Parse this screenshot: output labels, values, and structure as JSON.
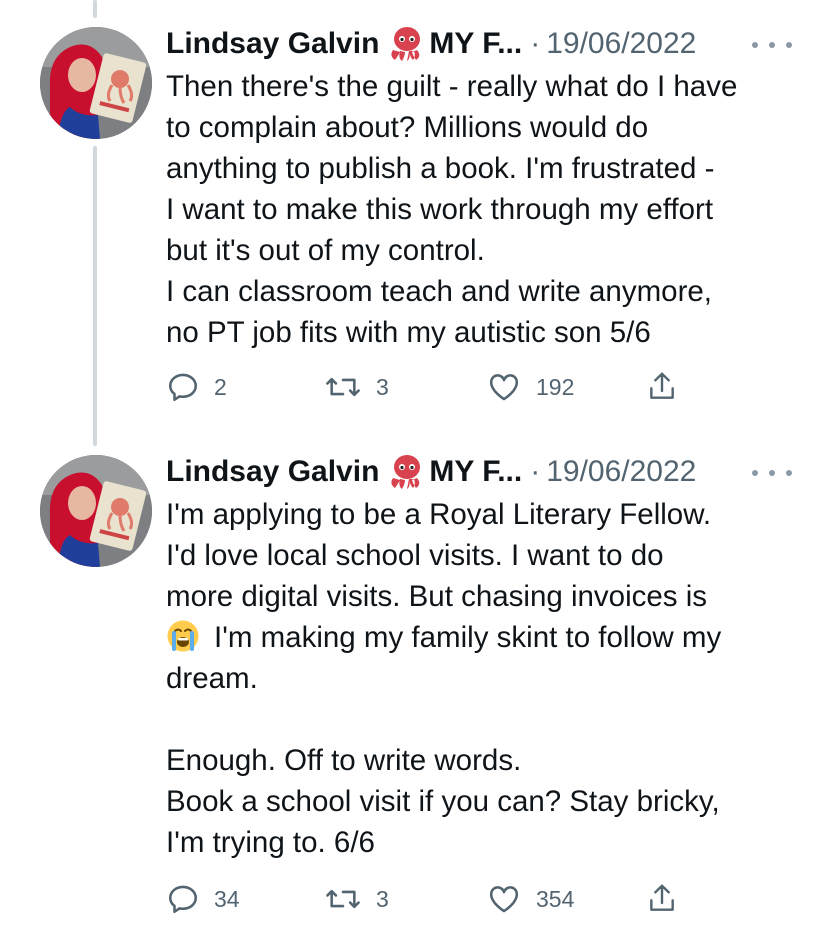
{
  "tweets": [
    {
      "author_name": "Lindsay Galvin",
      "author_suffix": "MY F...",
      "separator": "·",
      "date": "19/06/2022",
      "avatar_icon": "author-avatar",
      "lines": [
        "Then there's the guilt - really what do I have",
        "to complain about? Millions would do",
        "anything to publish a book. I'm frustrated -",
        "I want to make this work through my effort",
        "but it's out of my control.",
        "I can classroom teach and write anymore,",
        "no PT job fits with my autistic son 5/6"
      ],
      "replies": "2",
      "retweets": "3",
      "likes": "192"
    },
    {
      "author_name": "Lindsay Galvin",
      "author_suffix": "MY F...",
      "separator": "·",
      "date": "19/06/2022",
      "avatar_icon": "author-avatar",
      "lines": [
        "I'm applying to be a Royal Literary Fellow.",
        "I'd love local school visits. I want to do",
        "more digital visits. But chasing invoices is",
        "I'm making my family skint to follow my",
        "dream.",
        "",
        "Enough. Off to write words.",
        "Book a school visit if you can?  Stay bricky,",
        "I'm trying to. 6/6"
      ],
      "replies": "34",
      "retweets": "3",
      "likes": "354"
    }
  ],
  "icons": {
    "reply": "reply-icon",
    "retweet": "retweet-icon",
    "like": "like-icon",
    "share": "share-icon",
    "more": "more-options-icon",
    "emoji_name": "octopus-emoji",
    "emoji_body": "loudly-crying-face-emoji"
  },
  "colors": {
    "text": "#0f1419",
    "secondary": "#536471",
    "thread_line": "#cfd9de",
    "octopus": "#d8424e"
  }
}
